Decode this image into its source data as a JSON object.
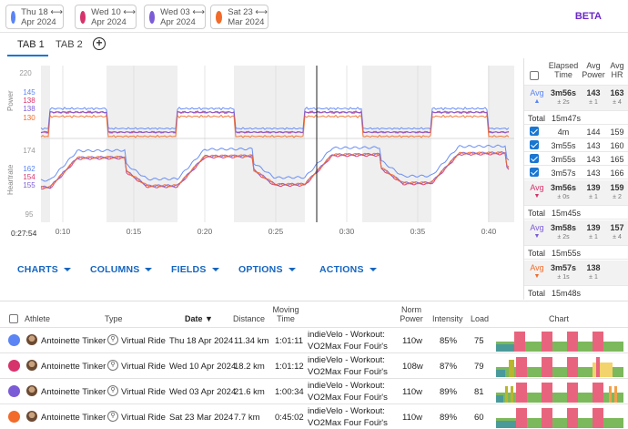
{
  "header": {
    "chips": [
      {
        "line1": "Thu 18 ⟷",
        "line2": "Apr 2024",
        "color": "#5b84f4"
      },
      {
        "line1": "Wed 10 ⟷",
        "line2": "Apr 2024",
        "color": "#d6336c"
      },
      {
        "line1": "Wed 03 ⟷",
        "line2": "Apr 2024",
        "color": "#7b5cd6"
      },
      {
        "line1": "Sat 23 ⟷",
        "line2": "Mar 2024",
        "color": "#f26b2a"
      }
    ],
    "beta": "BETA"
  },
  "tabs": {
    "tab1": "TAB 1",
    "tab2": "TAB 2",
    "add_icon": "plus-circle-icon"
  },
  "chart": {
    "power_label": "Power",
    "hr_label": "Heartrate",
    "power_ticks": [
      "220",
      "145",
      "138",
      "138",
      "130"
    ],
    "hr_ticks": [
      "174",
      "162",
      "154",
      "155",
      "95"
    ],
    "cursor_time": "0:27:54",
    "x_ticks": [
      "0:10",
      "0:15",
      "0:20",
      "0:25",
      "0:30",
      "0:35",
      "0:40"
    ]
  },
  "chart_data": {
    "type": "line",
    "x_ticks": [
      "0:10",
      "0:15",
      "0:20",
      "0:25",
      "0:30",
      "0:35",
      "0:40"
    ],
    "series": [
      {
        "color": "#5b84f4",
        "power_level": 145,
        "hr_level": 162
      },
      {
        "color": "#d6336c",
        "power_level": 138,
        "hr_level": 154
      },
      {
        "color": "#7b5cd6",
        "power_level": 138,
        "hr_level": 155
      },
      {
        "color": "#f26b2a",
        "power_level": 130,
        "hr_level": 155
      }
    ],
    "power_axis": [
      95,
      220
    ],
    "hr_axis": [
      95,
      174
    ],
    "grid": true
  },
  "right_panel": {
    "headers": {
      "elapsed": "Elapsed Time",
      "power": "Avg Power",
      "hr": "Avg HR"
    },
    "groups": [
      {
        "avg": "Avg",
        "color": "#5b84f4",
        "elapsed": "3m56s",
        "elapsed_sd": "± 2s",
        "power": "143",
        "power_sd": "± 1",
        "hr": "163",
        "hr_sd": "± 4",
        "total_label": "Total",
        "total": "15m47s"
      },
      {
        "avg": "Avg",
        "color": "#d6336c",
        "elapsed": "3m56s",
        "elapsed_sd": "± 0s",
        "power": "139",
        "power_sd": "± 1",
        "hr": "159",
        "hr_sd": "± 2",
        "total_label": "Total",
        "total": "15m45s"
      },
      {
        "avg": "Avg",
        "color": "#7b5cd6",
        "elapsed": "3m58s",
        "elapsed_sd": "± 2s",
        "power": "139",
        "power_sd": "± 1",
        "hr": "157",
        "hr_sd": "± 4",
        "total_label": "Total",
        "total": "15m55s"
      },
      {
        "avg": "Avg",
        "color": "#f26b2a",
        "elapsed": "3m57s",
        "elapsed_sd": "± 1s",
        "power": "138",
        "power_sd": "± 1",
        "hr": "",
        "hr_sd": "",
        "total_label": "Total",
        "total": "15m48s"
      }
    ],
    "laps": [
      {
        "elapsed": "4m",
        "power": "144",
        "hr": "159"
      },
      {
        "elapsed": "3m55s",
        "power": "143",
        "hr": "160"
      },
      {
        "elapsed": "3m55s",
        "power": "143",
        "hr": "165"
      },
      {
        "elapsed": "3m57s",
        "power": "143",
        "hr": "166"
      }
    ]
  },
  "menus": [
    "CHARTS",
    "COLUMNS",
    "FIELDS",
    "OPTIONS",
    "ACTIONS"
  ],
  "table": {
    "headers": {
      "athlete": "Athlete",
      "type": "Type",
      "date": "Date ▼",
      "distance": "Distance",
      "moving": "Moving Time",
      "name": "",
      "np": "Norm Power",
      "intensity": "Intensity",
      "load": "Load",
      "chart": "Chart"
    },
    "rows": [
      {
        "color": "#5b84f4",
        "athlete": "Antoinette Tinker",
        "type": "Virtual Ride",
        "date": "Thu 18 Apr 2024",
        "distance": "11.34 km",
        "moving": "1:01:11",
        "name1": "indieVelo - Workout:",
        "name2": "VO2Max Four Four's",
        "np": "110w",
        "intensity": "85%",
        "load": "75"
      },
      {
        "color": "#d6336c",
        "athlete": "Antoinette Tinker",
        "type": "Virtual Ride",
        "date": "Wed 10 Apr 2024",
        "distance": "18.2 km",
        "moving": "1:01:12",
        "name1": "indieVelo - Workout:",
        "name2": "VO2Max Four Four's",
        "np": "108w",
        "intensity": "87%",
        "load": "79"
      },
      {
        "color": "#7b5cd6",
        "athlete": "Antoinette Tinker",
        "type": "Virtual Ride",
        "date": "Wed 03 Apr 2024",
        "distance": "21.6 km",
        "moving": "1:00:34",
        "name1": "indieVelo - Workout:",
        "name2": "VO2Max Four Four's",
        "np": "110w",
        "intensity": "89%",
        "load": "81"
      },
      {
        "color": "#f26b2a",
        "athlete": "Antoinette Tinker",
        "type": "Virtual Ride",
        "date": "Sat 23 Mar 2024",
        "distance": "7.7 km",
        "moving": "0:45:02",
        "name1": "indieVelo - Workout:",
        "name2": "VO2Max Four Four's",
        "np": "110w",
        "intensity": "89%",
        "load": "60"
      }
    ]
  }
}
